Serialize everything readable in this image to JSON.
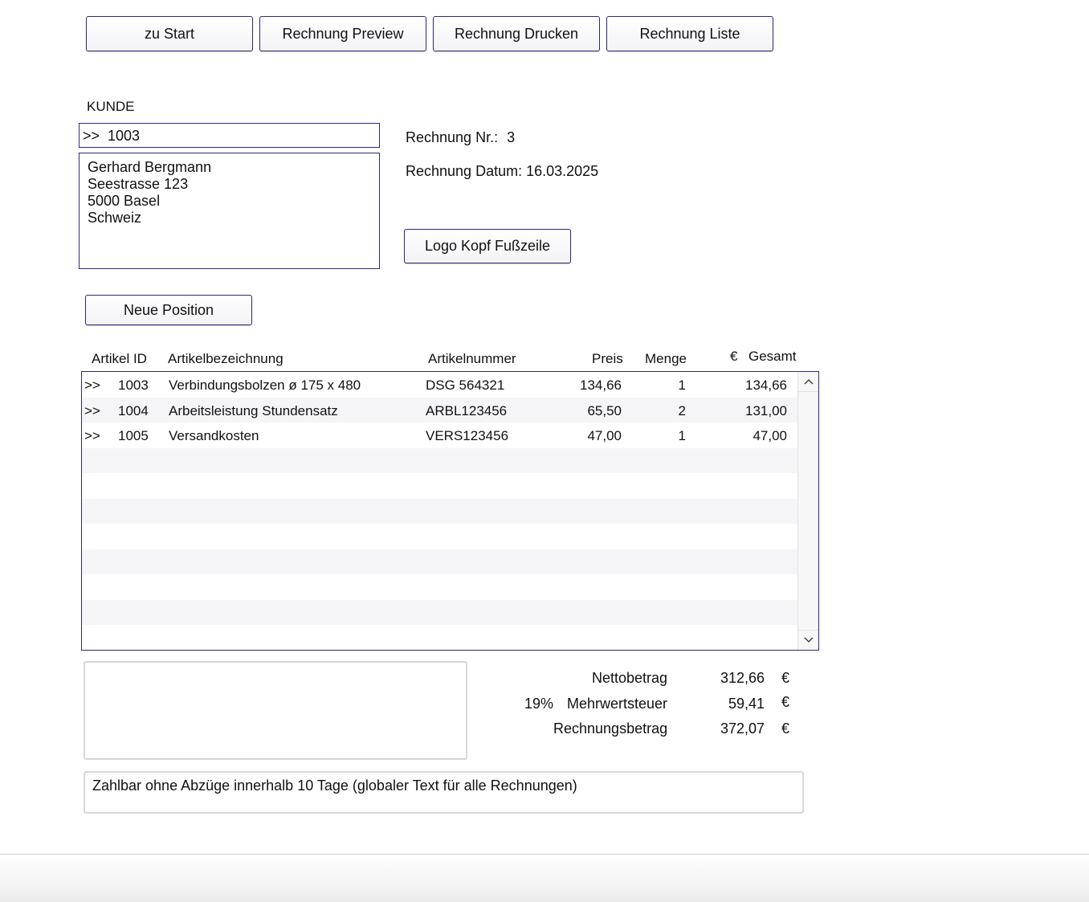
{
  "toolbar": {
    "start": "zu Start",
    "preview": "Rechnung Preview",
    "print": "Rechnung Drucken",
    "list": "Rechnung Liste"
  },
  "customer": {
    "heading": "KUNDE",
    "id_field": ">>  1003",
    "address_lines": [
      "Gerhard Bergmann",
      "Seestrasse 123",
      "5000 Basel",
      "Schweiz"
    ]
  },
  "invoice": {
    "number_label": "Rechnung Nr.:",
    "number_value": "3",
    "date_label": "Rechnung Datum:",
    "date_value": "16.03.2025",
    "logo_button": "Logo Kopf Fußzeile"
  },
  "positions": {
    "new_button": "Neue Position",
    "columns": {
      "artikel_id": "Artikel ID",
      "bezeichnung": "Artikelbezeichnung",
      "nummer": "Artikelnummer",
      "preis": "Preis",
      "menge": "Menge",
      "currency": "€",
      "gesamt": "Gesamt"
    },
    "rows": [
      {
        "marker": ">>",
        "id": "1003",
        "name": "Verbindungsbolzen ø 175 x 480",
        "number": "DSG 564321",
        "price": "134,66",
        "qty": "1",
        "total": "134,66"
      },
      {
        "marker": ">>",
        "id": "1004",
        "name": "Arbeitsleistung Stundensatz",
        "number": "ARBL123456",
        "price": "65,50",
        "qty": "2",
        "total": "131,00"
      },
      {
        "marker": ">>",
        "id": "1005",
        "name": "Versandkosten",
        "number": "VERS123456",
        "price": "47,00",
        "qty": "1",
        "total": "47,00"
      }
    ],
    "empty_rows": 8,
    "scroll_up_icon": "chevron-up-icon",
    "scroll_down_icon": "chevron-down-icon"
  },
  "totals": {
    "net_label": "Nettobetrag",
    "net_value": "312,66",
    "vat_rate": "19%",
    "vat_label": "Mehrwertsteuer",
    "vat_value": "59,41",
    "gross_label": "Rechnungsbetrag",
    "gross_value": "372,07",
    "currency": "€"
  },
  "footer_text": "Zahlbar ohne Abzüge innerhalb 10 Tage (globaler Text für alle Rechnungen)",
  "colors": {
    "border": "#2e2a7a",
    "row_stripe": "#f5f5f7"
  }
}
